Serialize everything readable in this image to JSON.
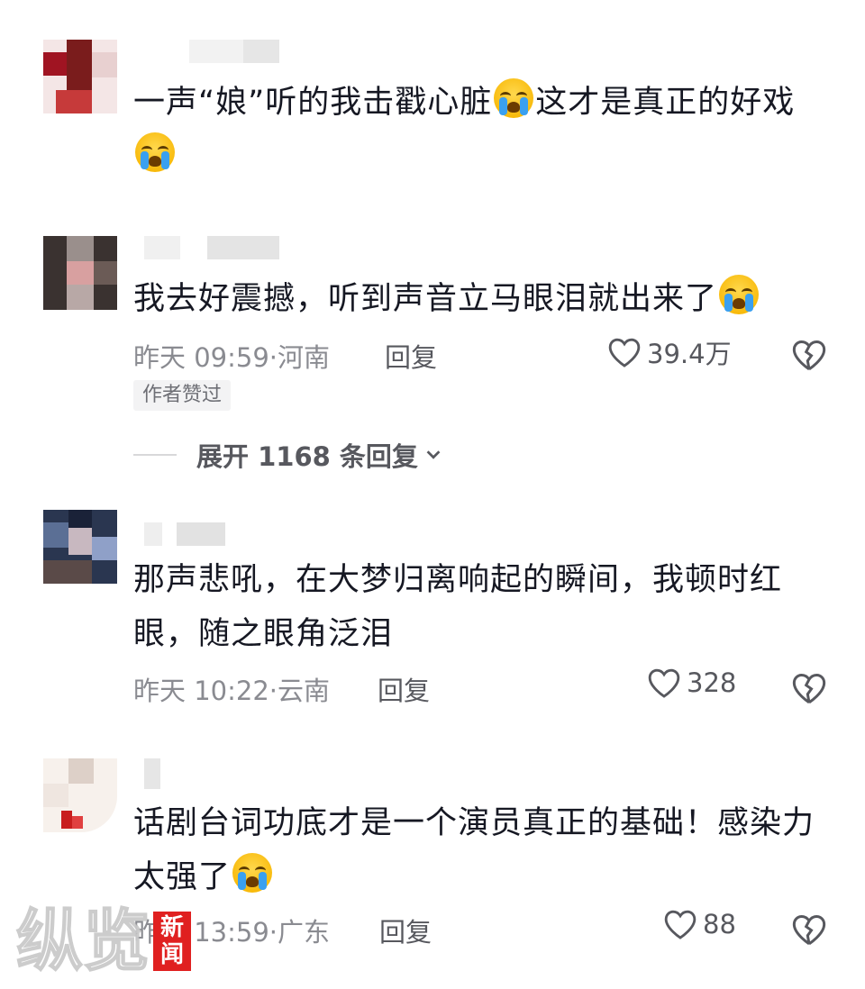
{
  "comments": [
    {
      "text_a": "一声“娘”听的我击戳心脏",
      "text_b": "这才是真正的好戏",
      "text_c": ""
    },
    {
      "text_a": "我去好震撼，听到声音立马眼泪就出来了",
      "time": "昨天 09:59",
      "location": "河南",
      "reply_label": "回复",
      "likes": "39.4万",
      "author_badge": "作者赞过",
      "expand_label": "展开 1168 条回复"
    },
    {
      "text_a": "那声悲吼，在大梦归离响起的瞬间，我顿时红\n眼，随之眼角泛泪",
      "time": "昨天 10:22",
      "location": "云南",
      "reply_label": "回复",
      "likes": "328"
    },
    {
      "text_a": "话剧台词功底才是一个演员真正的基础！感染力\n太强了",
      "time": "昨天 13:59",
      "location": "广东",
      "reply_label": "回复",
      "likes": "88"
    }
  ],
  "watermark": {
    "brand": "纵览",
    "box_line1": "新",
    "box_line2": "闻"
  },
  "icons": {
    "like": "heart-outline-icon",
    "dislike": "broken-heart-icon",
    "emoji": "loudly-crying-face-emoji",
    "expand": "chevron-down-icon"
  },
  "colors": {
    "text": "#161823",
    "meta": "#8a8b91",
    "action": "#57585e",
    "watermark_box": "#e02020"
  }
}
